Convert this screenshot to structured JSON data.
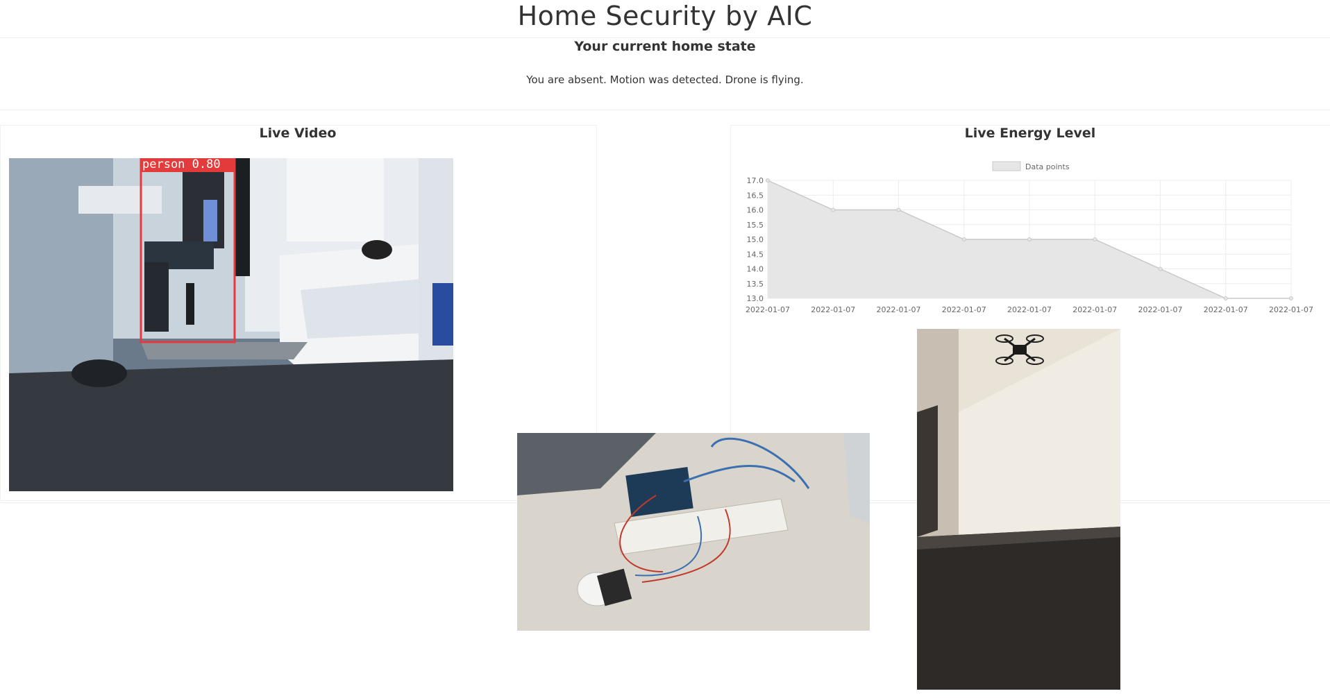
{
  "page": {
    "title": "Home Security by AIC",
    "state_heading": "Your current home state",
    "status_text": "You are absent. Motion was detected. Drone is flying."
  },
  "live_video": {
    "title": "Live Video",
    "detection_label": "person 0.80"
  },
  "energy": {
    "title": "Live Energy Level"
  },
  "chart_data": {
    "type": "area",
    "legend": [
      "Data points"
    ],
    "legend_position": "top-center",
    "grid": true,
    "x": [
      "2022-01-07",
      "2022-01-07",
      "2022-01-07",
      "2022-01-07",
      "2022-01-07",
      "2022-01-07",
      "2022-01-07",
      "2022-01-07",
      "2022-01-07"
    ],
    "series": [
      {
        "name": "Data points",
        "values": [
          17.0,
          16.0,
          16.0,
          15.0,
          15.0,
          15.0,
          14.0,
          13.0,
          13.0
        ]
      }
    ],
    "yticks": [
      "17.0",
      "16.5",
      "16.0",
      "15.5",
      "15.0",
      "14.5",
      "14.0",
      "13.5",
      "13.0"
    ],
    "ylim": [
      13.0,
      17.0
    ],
    "colors": {
      "fill": "#e6e6e6",
      "line": "#c8c8c8",
      "grid": "#ececec"
    }
  }
}
